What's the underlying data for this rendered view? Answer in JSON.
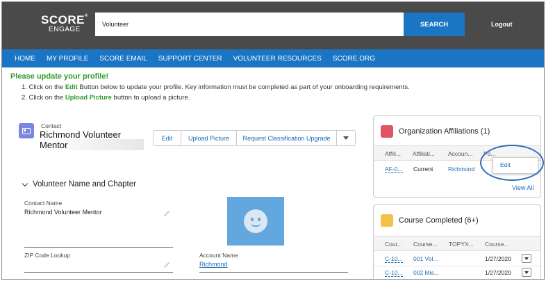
{
  "header": {
    "logo_line1": "SCORE",
    "logo_mark": "®",
    "logo_line2": "ENGAGE",
    "search_value": "Volunteer",
    "search_button": "SEARCH",
    "logout": "Logout"
  },
  "nav": [
    "HOME",
    "MY PROFILE",
    "SCORE EMAIL",
    "SUPPORT CENTER",
    "VOLUNTEER RESOURCES",
    "SCORE.ORG"
  ],
  "notice": {
    "heading": "Please update your profile!",
    "line1_a": "1. Click on the ",
    "line1_b": "Edit",
    "line1_c": " Button below to update your profile. Key information must be completed as part of your onboarding requirements.",
    "line2_a": "2. Click on the ",
    "line2_b": "Upload Picture",
    "line2_c": " button to upload a picture."
  },
  "contact": {
    "type_label": "Contact",
    "name": "Richmond Volunteer Mentor",
    "icon": "contact-card-icon",
    "actions": {
      "edit": "Edit",
      "upload": "Upload Picture",
      "classification": "Request Classification Upgrade"
    }
  },
  "section": {
    "title": "Volunteer Name and Chapter",
    "contact_name_label": "Contact Name",
    "contact_name_value": "Richmond Volunteer Mentor",
    "zip_label": "ZIP Code Lookup",
    "account_label": "Account Name",
    "account_value": "Richmond"
  },
  "affiliations": {
    "title": "Organization Affiliations (1)",
    "icon_color": "#e05563",
    "columns": [
      "Affili...",
      "Affiliati...",
      "Accoun...",
      "Po..."
    ],
    "rows": [
      [
        "AF-0...",
        "Current",
        "Richmond"
      ]
    ],
    "menu_edit": "Edit",
    "view_all": "View All"
  },
  "courses": {
    "title": "Course Completed (6+)",
    "icon_color": "#f0c24a",
    "columns": [
      "Cour...",
      "Course...",
      "TOPYX...",
      "Course..."
    ],
    "rows": [
      [
        "C-10...",
        "001 Vol...",
        "",
        "1/27/2020"
      ],
      [
        "C-10...",
        "002 Mis...",
        "",
        "1/27/2020"
      ]
    ]
  }
}
